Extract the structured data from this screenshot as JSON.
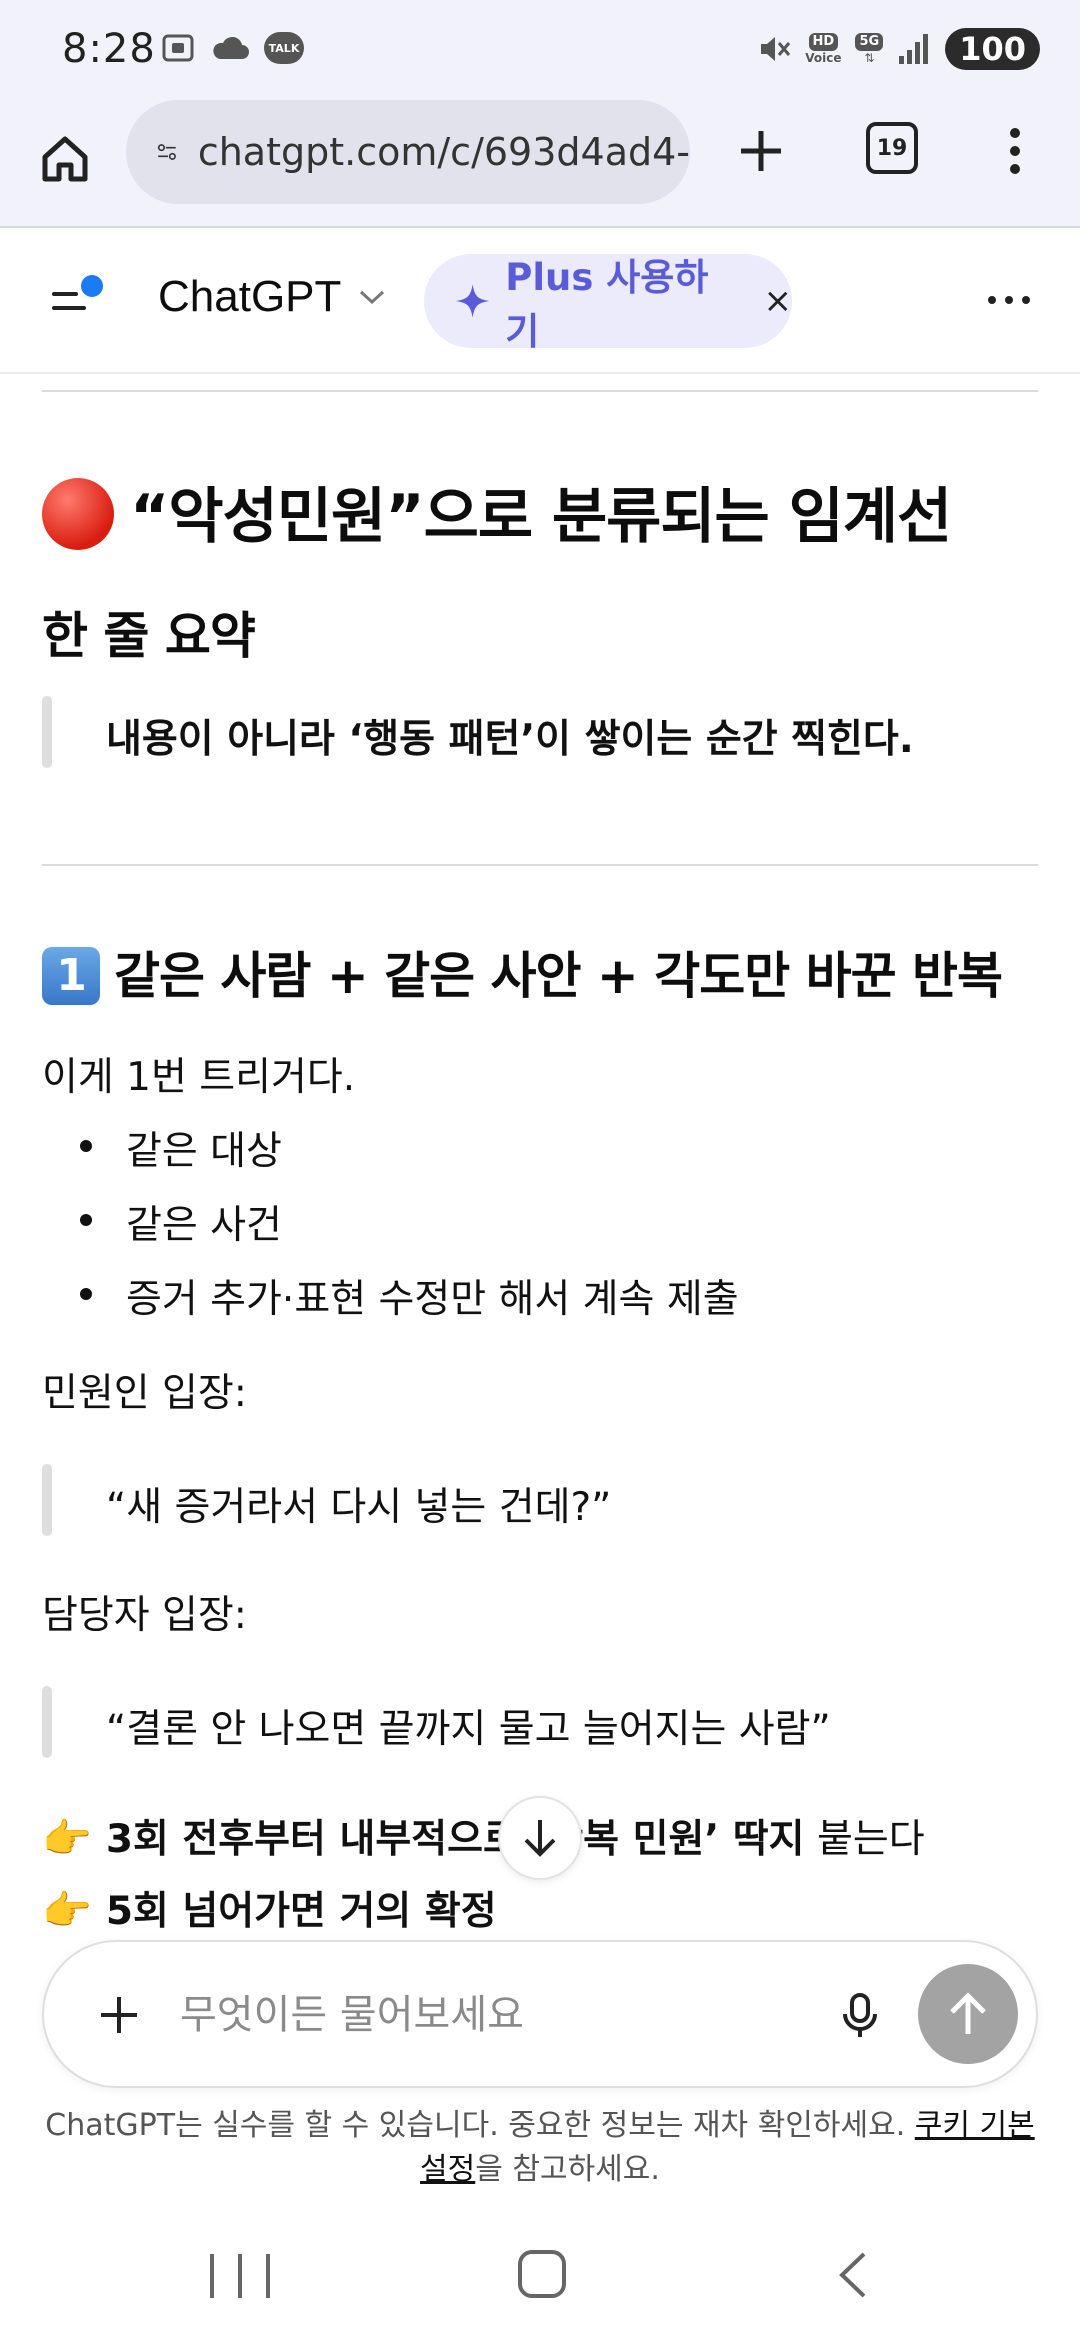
{
  "status_bar": {
    "time": "8:28",
    "battery": "100",
    "icons": [
      "screenshot-icon",
      "cloud-icon",
      "talk-icon",
      "mute-icon",
      "hd-voice-icon",
      "5g-icon",
      "signal-icon"
    ],
    "talk_label": "TALK",
    "hd_label": "HD",
    "voice_label": "Voice",
    "fiveg_label": "5G"
  },
  "browser": {
    "url": "chatgpt.com/c/693d4ad4-",
    "tab_count": "19"
  },
  "header": {
    "model_name": "ChatGPT",
    "plus_label": "Plus 사용하기",
    "plus_close": "×"
  },
  "content": {
    "section_title": "“악성민원”으로 분류되는 임계선",
    "summary_heading": "한 줄 요약",
    "summary_quote": "내용이 아니라 ‘행동 패턴’이 쌓이는 순간 찍힌다.",
    "subsection": {
      "number": "1",
      "title": "같은 사람 + 같은 사안 + 각도만 바꾼 반복",
      "intro": "이게 1번 트리거다.",
      "bullets": [
        "같은 대상",
        "같은 사건",
        "증거 추가·표현 수정만 해서 계속 제출"
      ],
      "complainant_label": "민원인 입장:",
      "complainant_quote": "“새 증거라서 다시 넣는 건데?”",
      "officer_label": "담당자 입장:",
      "officer_quote": "“결론 안 나오면 끝까지 물고 늘어지는 사람”",
      "point1_bold": "3회 전후부터 내부적으로 ‘반복 민원’ 딱지",
      "point1_rest": " 붙는다",
      "point2_bold": "5회 넘어가면 거의 확정"
    }
  },
  "composer": {
    "placeholder": "무엇이든 물어보세요"
  },
  "disclaimer": {
    "text": "ChatGPT는 실수를 할 수 있습니다. 중요한 정보는 재차 확인하세요. ",
    "link": "쿠키 기본 설정",
    "suffix": "을 참고하세요."
  }
}
